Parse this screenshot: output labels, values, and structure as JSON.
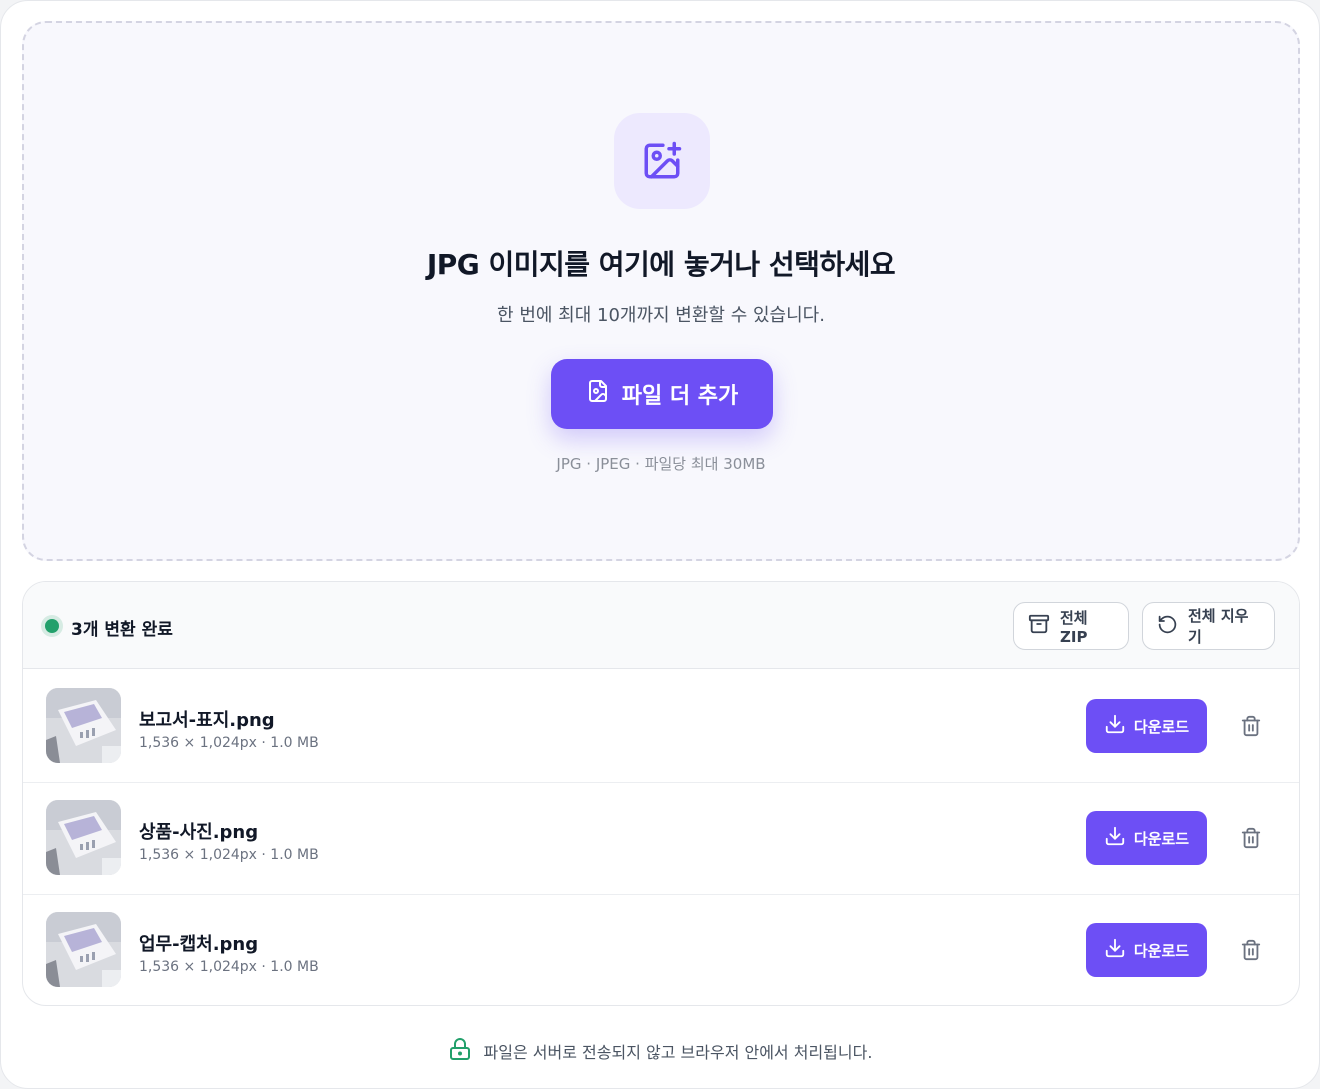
{
  "upload": {
    "icon": "image-plus-icon",
    "title": "JPG 이미지를 여기에 놓거나 선택하세요",
    "subtitle": "한 번에 최대 10개까지 변환할 수 있습니다.",
    "add_button_label": "파일 더 추가",
    "add_button_icon": "file-image-icon",
    "note": "JPG · JPEG · 파일당 최대 30MB"
  },
  "results": {
    "status_text": "3개 변환 완료",
    "zip_label": "전체 ZIP",
    "clear_label": "전체 지우기",
    "files": [
      {
        "name": "보고서-표지.png",
        "meta": "1,536 × 1,024px · 1.0 MB",
        "download_label": "다운로드"
      },
      {
        "name": "상품-사진.png",
        "meta": "1,536 × 1,024px · 1.0 MB",
        "download_label": "다운로드"
      },
      {
        "name": "업무-캡처.png",
        "meta": "1,536 × 1,024px · 1.0 MB",
        "download_label": "다운로드"
      }
    ]
  },
  "footer": {
    "privacy_text": "파일은 서버로 전송되지 않고 브라우저 안에서 처리됩니다."
  },
  "colors": {
    "accent": "#6d4ff5",
    "success": "#22a06b",
    "lock": "#22a06b"
  }
}
